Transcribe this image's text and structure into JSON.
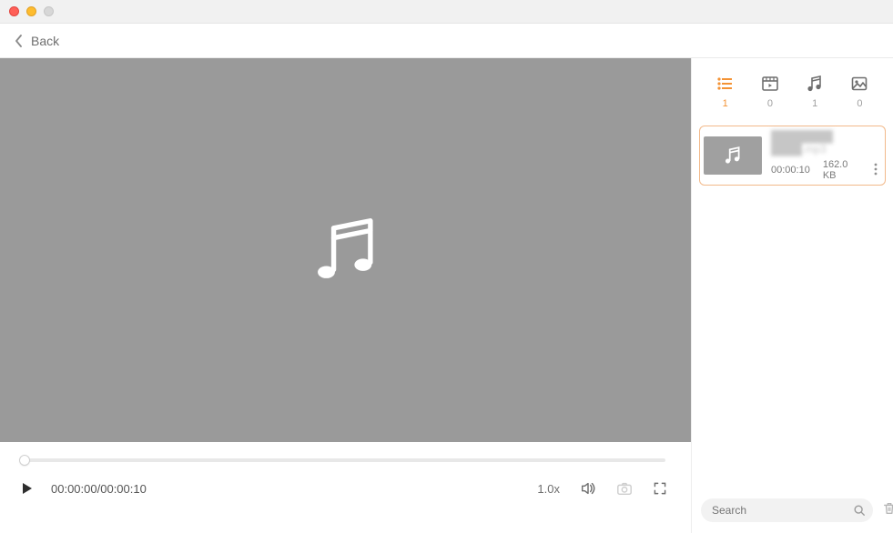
{
  "header": {
    "back_label": "Back"
  },
  "player": {
    "time_current": "00:00:00",
    "time_total": "00:00:10",
    "speed_label": "1.0x"
  },
  "sidebar": {
    "tabs": [
      {
        "id": "list",
        "count": "1",
        "active": true
      },
      {
        "id": "video",
        "count": "0",
        "active": false
      },
      {
        "id": "audio",
        "count": "1",
        "active": false
      },
      {
        "id": "image",
        "count": "0",
        "active": false
      }
    ],
    "items": [
      {
        "title": "████████ ████.mp3",
        "duration": "00:00:10",
        "size": "162.0 KB"
      }
    ],
    "search_placeholder": "Search"
  }
}
